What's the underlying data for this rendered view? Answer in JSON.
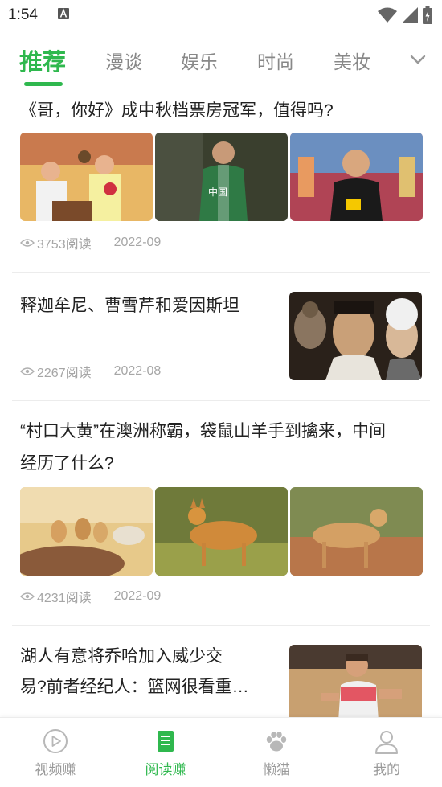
{
  "status_bar": {
    "time": "1:54"
  },
  "tabs": {
    "items": [
      {
        "label": "推荐",
        "active": true
      },
      {
        "label": "漫谈",
        "active": false
      },
      {
        "label": "娱乐",
        "active": false
      },
      {
        "label": "时尚",
        "active": false
      },
      {
        "label": "美妆",
        "active": false
      }
    ],
    "more_icon": "chevron-down-icon",
    "accent_color": "#2fb84e"
  },
  "articles": [
    {
      "title": "《哥，你好》成中秋档票房冠军，值得吗?",
      "reads": "3753阅读",
      "date": "2022-09",
      "layout": "three-images"
    },
    {
      "title": "释迦牟尼、曹雪芹和爱因斯坦",
      "reads": "2267阅读",
      "date": "2022-08",
      "layout": "side-image"
    },
    {
      "title_line1": "“村口大黄”在澳洲称霸，袋鼠山羊手到擒来，中间",
      "title_line2": "经历了什么?",
      "reads": "4231阅读",
      "date": "2022-09",
      "layout": "three-images"
    },
    {
      "title_line1": "湖人有意将乔哈加入威少交",
      "title_line2": "易?前者经纪人：篮网很看重…",
      "layout": "side-image"
    }
  ],
  "bottom_nav": {
    "items": [
      {
        "label": "视频赚",
        "icon": "play-circle-icon",
        "active": false
      },
      {
        "label": "阅读赚",
        "icon": "document-icon",
        "active": true
      },
      {
        "label": "懒猫",
        "icon": "paw-icon",
        "active": false
      },
      {
        "label": "我的",
        "icon": "user-icon",
        "active": false
      }
    ]
  }
}
